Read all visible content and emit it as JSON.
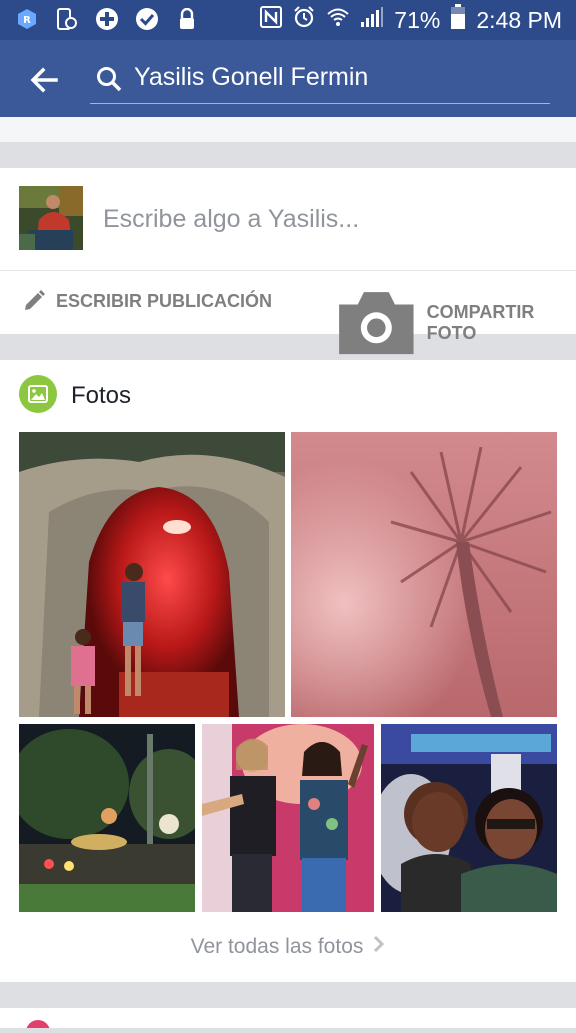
{
  "status_bar": {
    "battery": "71%",
    "time": "2:48 PM"
  },
  "app_bar": {
    "search_query": "Yasilis Gonell Fermin"
  },
  "composer": {
    "prompt": "Escribe algo a Yasilis...",
    "write_post_label": "ESCRIBIR PUBLICACIÓN",
    "share_photo_label": "COMPARTIR FOTO"
  },
  "photos": {
    "title": "Fotos",
    "see_all_label": "Ver todas las fotos"
  },
  "colors": {
    "status_bar": "#2d4a8a",
    "app_bar": "#3b5998",
    "photos_icon": "#8dc63f"
  }
}
